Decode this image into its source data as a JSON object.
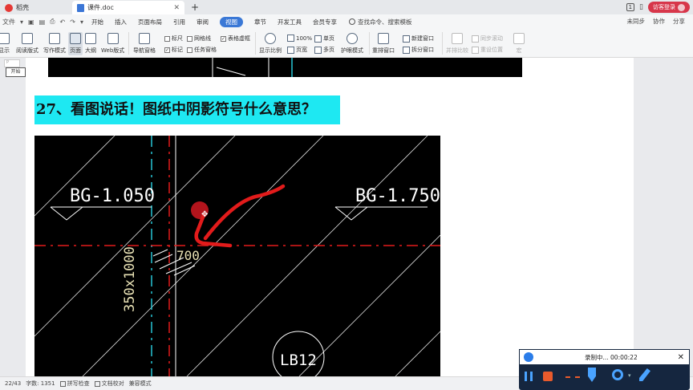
{
  "titlebar": {
    "home_tab": "稻壳",
    "doc_tab": "课件.doc",
    "page_badge": "1",
    "login_label": "访客登录"
  },
  "menubar": {
    "file": "文件",
    "items": [
      "开始",
      "插入",
      "页面布局",
      "引用",
      "审阅",
      "视图",
      "章节",
      "开发工具",
      "会员专享"
    ],
    "active_item": "视图",
    "search_label": "查找命令、搜索模板",
    "right": [
      "未同步",
      "协作",
      "分享"
    ]
  },
  "ribbon": {
    "display": "显示",
    "read_layout": "阅读版式",
    "write_mode": "写作模式",
    "page": "页面",
    "outline": "大纲",
    "web_layout": "Web版式",
    "nav_pane": "导航窗格",
    "ruler": "标尺",
    "gridlines": "网格线",
    "table_borders": "表格虚框",
    "markup": "标记",
    "task_pane": "任务窗格",
    "zoom_label": "显示比例",
    "zoom_100": "100%",
    "page_width": "页宽",
    "single_page": "单页",
    "multi_page": "多页",
    "eye_mode": "护眼模式",
    "rearrange": "重排窗口",
    "new_window": "新建窗口",
    "split_window": "拆分窗口",
    "side_by_side": "并排比较",
    "sync_scroll": "同步滚动",
    "reset_position": "重设位置",
    "macro": "宏"
  },
  "document": {
    "start_button": "开始",
    "small_placeholder": "P",
    "question": "27、看图说话！图纸中阴影符号什么意思？"
  },
  "cad": {
    "label_left": "BG-1.050",
    "label_right": "BG-1.750",
    "dim_700": "700",
    "dim_vertical": "350x1000",
    "beam_label": "LB12"
  },
  "statusbar": {
    "page": "22/43",
    "words": "字数: 1351",
    "spellcheck": "拼写检查",
    "doc_check": "文档校对",
    "compat": "兼容模式"
  },
  "recorder": {
    "status": "录制中... 00:00:22"
  }
}
